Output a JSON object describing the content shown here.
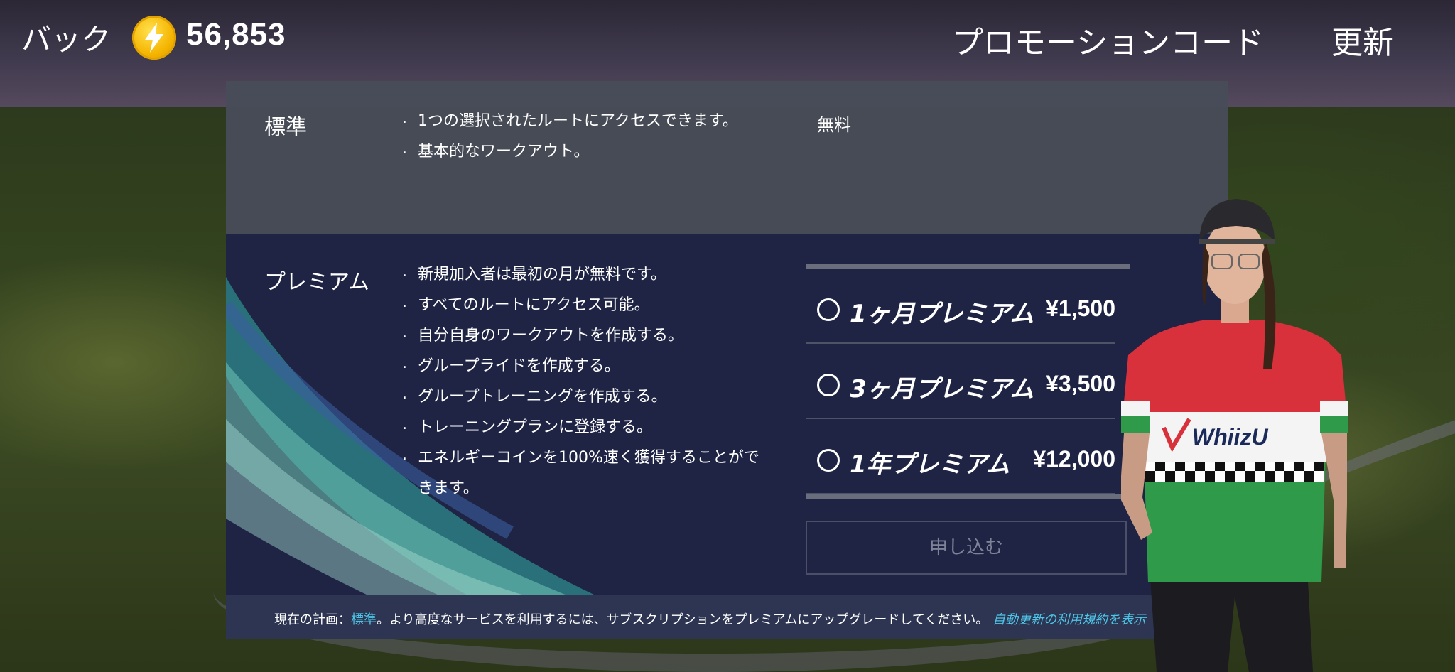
{
  "topbar": {
    "back_label": "バック",
    "coin_icon": "energy-coin-icon",
    "coin_count": "56,853",
    "promo_label": "プロモーションコード",
    "refresh_label": "更新"
  },
  "standard": {
    "name": "標準",
    "features": [
      "1つの選択されたルートにアクセスできます。",
      "基本的なワークアウト。"
    ],
    "price": "無料"
  },
  "premium": {
    "name": "プレミアム",
    "features": [
      "新規加入者は最初の月が無料です。",
      "すべてのルートにアクセス可能。",
      "自分自身のワークアウトを作成する。",
      "グループライドを作成する。",
      "グループトレーニングを作成する。",
      "トレーニングプランに登録する。",
      "エネルギーコインを100%速く獲得することができます。"
    ],
    "options": [
      {
        "label": "1ヶ月プレミアム",
        "price": "¥1,500"
      },
      {
        "label": "3ヶ月プレミアム",
        "price": "¥3,500"
      },
      {
        "label": "1年プレミアム",
        "price": "¥12,000"
      }
    ],
    "subscribe_label": "申し込む"
  },
  "footer": {
    "prefix": "現在の計画：",
    "current_plan": "標準",
    "message": "。より高度なサービスを利用するには、サブスクリプションをプレミアムにアップグレードしてください。",
    "terms_link": "自動更新の利用規約を表示"
  },
  "character": {
    "jersey_brand": "WhiizU"
  },
  "colors": {
    "accent": "#4ec6e8",
    "coin": "#f5b400",
    "premium_panel": "#1f2444",
    "standard_panel": "#484c58"
  }
}
